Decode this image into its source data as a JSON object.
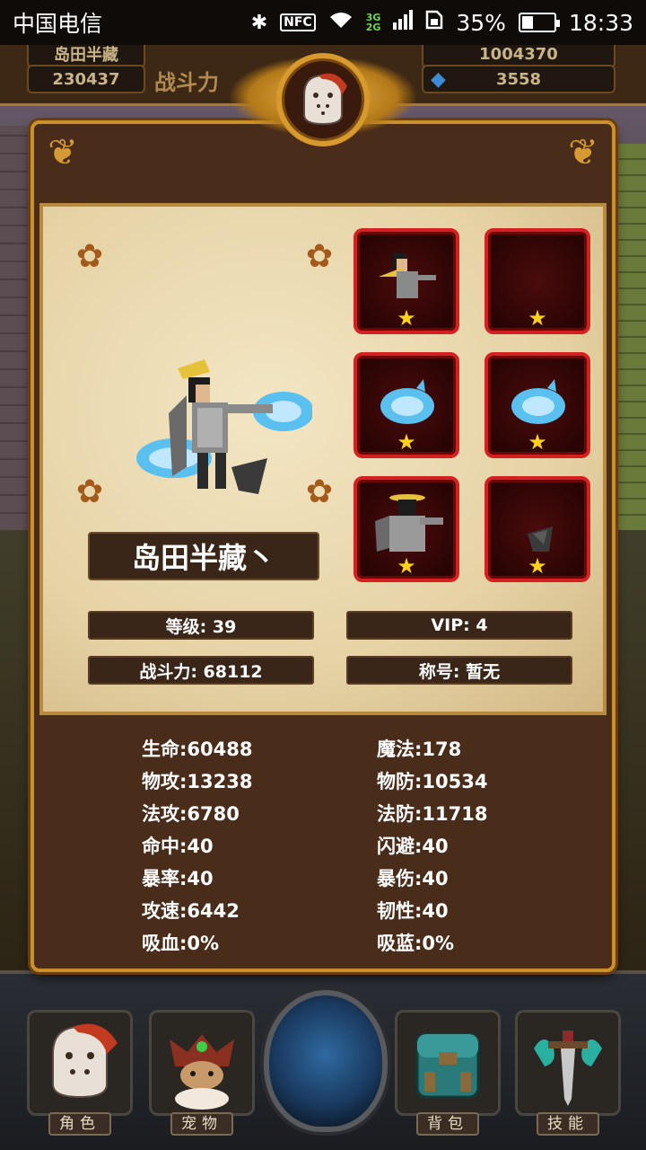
{
  "status_bar": {
    "carrier": "中国电信",
    "nfc": "NFC",
    "network": [
      "3G",
      "2G"
    ],
    "battery": "35%",
    "time": "18:33"
  },
  "top_hud": {
    "name_partial": "岛田半藏",
    "power_value": "230437",
    "power_label": "战斗力",
    "gold_partial": "1004370",
    "gems": "3558"
  },
  "profile": {
    "name": "岛田半藏丶",
    "level": "等级: 39",
    "vip": "VIP: 4",
    "power": "战斗力: 68112",
    "title": "称号: 暂无"
  },
  "equipment_slots": [
    {
      "icon": "hero-mini-icon",
      "stars": 1
    },
    {
      "icon": "empty-slot",
      "stars": 1
    },
    {
      "icon": "ice-spirit-icon",
      "stars": 1
    },
    {
      "icon": "ice-spirit-icon",
      "stars": 1
    },
    {
      "icon": "armor-icon",
      "stars": 1
    },
    {
      "icon": "boots-icon",
      "stars": 1
    }
  ],
  "stats_left": [
    "生命:60488",
    "物攻:13238",
    "法攻:6780",
    "命中:40",
    "暴率:40",
    "攻速:6442",
    "吸血:0%"
  ],
  "stats_right": [
    "魔法:178",
    "物防:10534",
    "法防:11718",
    "闪避:40",
    "暴伤:40",
    "韧性:40",
    "吸蓝:0%"
  ],
  "bottom_nav": [
    {
      "label": "角色",
      "icon": "gladiator-helmet-icon"
    },
    {
      "label": "宠物",
      "icon": "pet-egg-icon"
    },
    {
      "label": "",
      "icon": "center-shield-icon"
    },
    {
      "label": "背包",
      "icon": "backpack-icon"
    },
    {
      "label": "技能",
      "icon": "sword-skill-icon"
    }
  ],
  "colors": {
    "panel_border": "#c9902c",
    "slot_border": "#d42020",
    "star": "#ffd21a",
    "parchment": "#e6d3a6"
  }
}
